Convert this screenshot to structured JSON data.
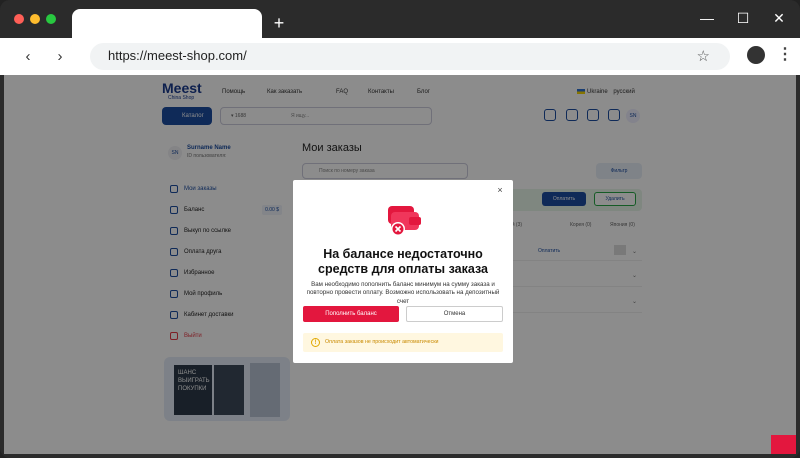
{
  "browser": {
    "url": "https://meest-shop.com/",
    "new_tab": "+",
    "back": "‹",
    "forward": "›",
    "bookmark": "☆",
    "menu": "⋮",
    "minimize": "—",
    "maximize": "☐",
    "close": "✕",
    "dots": [
      "#ff5f57",
      "#febc2e",
      "#28c840"
    ]
  },
  "site": {
    "logo": "Meest",
    "logo_sub": "China Shop",
    "nav": [
      "Помощь",
      "Как заказать",
      "FAQ",
      "Контакты",
      "Блог"
    ],
    "lang_country": "Ukraine",
    "lang": "русский",
    "catalog": "Каталог",
    "search_placeholder": "Я ищу...",
    "avatar": "SN"
  },
  "sidebar": {
    "user_name": "Surname Name",
    "user_id": "ID пользователя:",
    "avatar": "SN",
    "items": [
      {
        "label": "Мои заказы"
      },
      {
        "label": "Баланс",
        "badge": "0.00 $"
      },
      {
        "label": "Выкуп по ссылке"
      },
      {
        "label": "Оплата друга"
      },
      {
        "label": "Избранное"
      },
      {
        "label": "Мой профиль"
      },
      {
        "label": "Кабинет доставки"
      },
      {
        "label": "Выйти"
      }
    ],
    "promo_text": "ШАНС ВЫИГРАТЬ ПОКУПКИ"
  },
  "main": {
    "title": "Мои заказы",
    "search_placeholder": "Поиск по номеру заказа",
    "filter": "Фильтр",
    "pay": "Оплатить",
    "delete": "Удалить",
    "tabs": [
      "Китай (3)",
      "Корея (0)",
      "Япония (0)"
    ],
    "row_action": "Оплатить"
  },
  "modal": {
    "close": "×",
    "title": "На балансе недостаточно средств для оплаты заказа",
    "description": "Вам необходимо пополнить баланс минимум на сумму заказа и повторно провести оплату. Возможно использовать на депозитный счет",
    "primary_button": "Пополнить баланс",
    "secondary_button": "Отмена",
    "warning": "Оплата заказов не происходит автоматически",
    "warning_icon": "!",
    "accent_color": "#e3173e"
  }
}
